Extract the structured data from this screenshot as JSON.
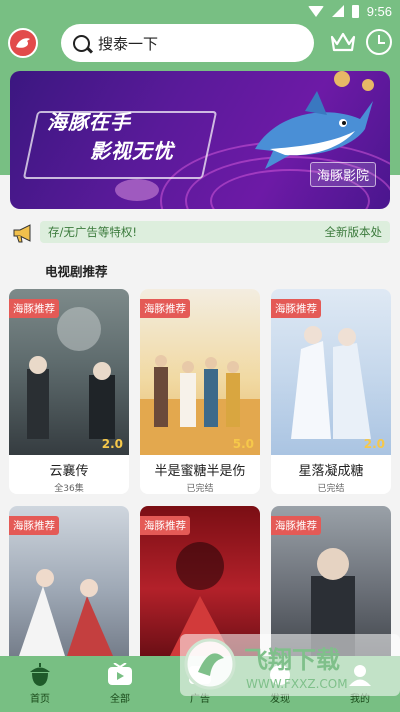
{
  "status_bar": {
    "time": "9:56"
  },
  "header": {
    "search_placeholder": "搜泰一下"
  },
  "banner": {
    "line1": "海豚在手",
    "line2": "影视无忧",
    "tag": "海豚影院"
  },
  "notice": {
    "left_text": "存/无广告等特权!",
    "right_text": "全新版本处"
  },
  "section": {
    "title": "电视剧推荐"
  },
  "cards": [
    {
      "badge": "海豚推荐",
      "score": "2.0",
      "title": "云襄传",
      "sub": "全36集"
    },
    {
      "badge": "海豚推荐",
      "score": "5.0",
      "title": "半是蜜糖半是伤",
      "sub": "已完结"
    },
    {
      "badge": "海豚推荐",
      "score": "2.0",
      "title": "星落凝成糖",
      "sub": "已完结"
    },
    {
      "badge": "海豚推荐",
      "score": "",
      "title": "",
      "sub": ""
    },
    {
      "badge": "海豚推荐",
      "score": "",
      "title": "",
      "sub": ""
    },
    {
      "badge": "海豚推荐",
      "score": "",
      "title": "",
      "sub": ""
    }
  ],
  "bottom_nav": [
    {
      "label": "首页",
      "icon": "acorn-icon"
    },
    {
      "label": "全部",
      "icon": "tv-icon"
    },
    {
      "label": "广告",
      "icon": "ad-icon"
    },
    {
      "label": "发现",
      "icon": "discover-icon"
    },
    {
      "label": "我的",
      "icon": "profile-icon"
    }
  ],
  "watermark": {
    "title": "飞翔下载",
    "url": "WWW.FXXZ.COM"
  },
  "colors": {
    "header_green": "#78bf83",
    "badge_red": "#e45a56",
    "score_yellow": "#f6c84a"
  }
}
